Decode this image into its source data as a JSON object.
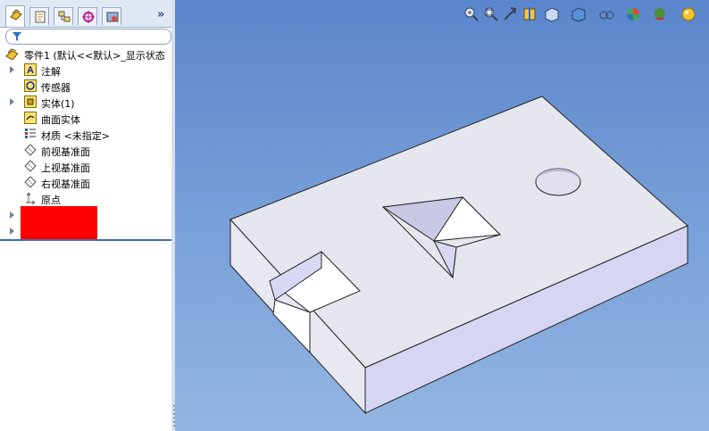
{
  "tabs": [
    {
      "icon": "feature-manager-icon",
      "active": true
    },
    {
      "icon": "property-manager-icon",
      "active": false
    },
    {
      "icon": "configuration-manager-icon",
      "active": false
    },
    {
      "icon": "dimxpert-icon",
      "active": false
    },
    {
      "icon": "display-manager-icon",
      "active": false
    }
  ],
  "more_label": "»",
  "tree": {
    "root_label": "零件1 (默认<<默认>_显示状态",
    "items": [
      {
        "label": "注解",
        "icon": "annotation-icon",
        "expandable": true
      },
      {
        "label": "传感器",
        "icon": "sensor-icon",
        "expandable": false
      },
      {
        "label": "实体(1)",
        "icon": "solid-body-icon",
        "expandable": true
      },
      {
        "label": "曲面实体",
        "icon": "surface-body-icon",
        "expandable": false
      },
      {
        "label": "材质 <未指定>",
        "icon": "material-icon",
        "expandable": false
      },
      {
        "label": "前视基准面",
        "icon": "plane-icon",
        "expandable": false
      },
      {
        "label": "上视基准面",
        "icon": "plane-icon",
        "expandable": false
      },
      {
        "label": "右视基准面",
        "icon": "plane-icon",
        "expandable": false
      },
      {
        "label": "原点",
        "icon": "origin-icon",
        "expandable": false
      }
    ]
  },
  "toolbar_icons": [
    "zoom-to-fit-icon",
    "zoom-area-icon",
    "previous-view-icon",
    "section-view-icon",
    "view-orientation-icon",
    "display-style-icon",
    "hide-show-icon",
    "appearance-icon",
    "scene-icon",
    "view-settings-icon"
  ],
  "colors": {
    "viewport_top": "#5b86cc",
    "viewport_bottom": "#93b5e2",
    "highlight": "#ff0000",
    "model_face": "#e6e6ee",
    "model_side": "#d8d8f4"
  }
}
